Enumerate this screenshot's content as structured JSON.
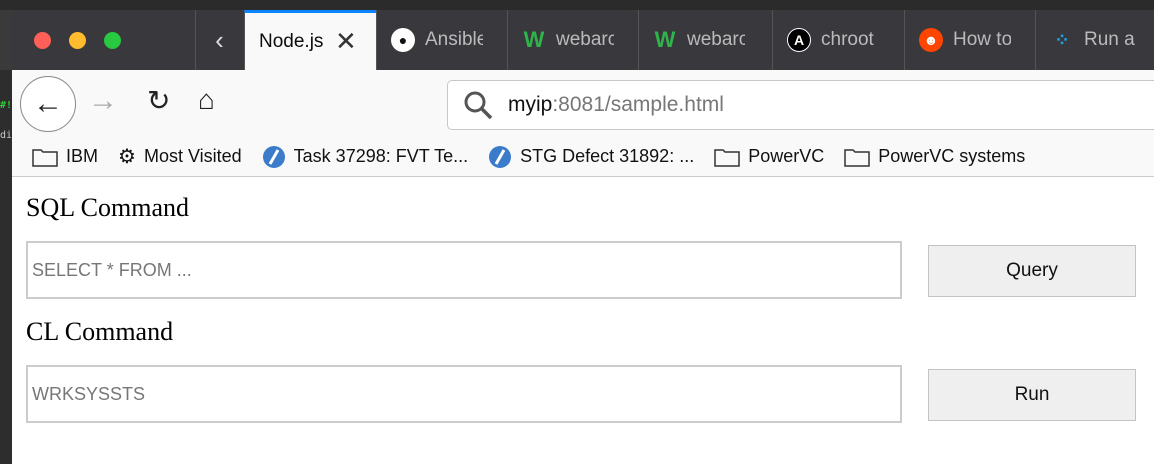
{
  "browser": {
    "tabs": [
      {
        "label": "Node.js",
        "icon": "nodejs-icon",
        "active": true
      },
      {
        "label": "Ansible",
        "icon": "github-icon"
      },
      {
        "label": "webarc",
        "icon": "webarc-icon"
      },
      {
        "label": "webarc",
        "icon": "webarc-icon"
      },
      {
        "label": "chroot",
        "icon": "ansible-icon"
      },
      {
        "label": "How to",
        "icon": "reddit-icon"
      },
      {
        "label": "Run a",
        "icon": "dots-icon"
      }
    ],
    "url_host": "myip",
    "url_rest": ":8081/sample.html",
    "bookmarks": [
      {
        "label": "IBM",
        "icon": "folder-icon"
      },
      {
        "label": "Most Visited",
        "icon": "gear-icon"
      },
      {
        "label": "Task 37298: FVT Te...",
        "icon": "rtc-icon"
      },
      {
        "label": "STG Defect 31892: ...",
        "icon": "rtc-icon"
      },
      {
        "label": "PowerVC",
        "icon": "folder-icon"
      },
      {
        "label": "PowerVC systems",
        "icon": "folder-icon"
      }
    ]
  },
  "page": {
    "sql": {
      "label": "SQL Command",
      "placeholder": "SELECT * FROM ...",
      "button": "Query"
    },
    "cl": {
      "label": "CL Command",
      "placeholder": "WRKSYSSTS",
      "button": "Run"
    }
  },
  "colors": {
    "accent": "#0a84ff",
    "tabbar": "#38383d"
  }
}
